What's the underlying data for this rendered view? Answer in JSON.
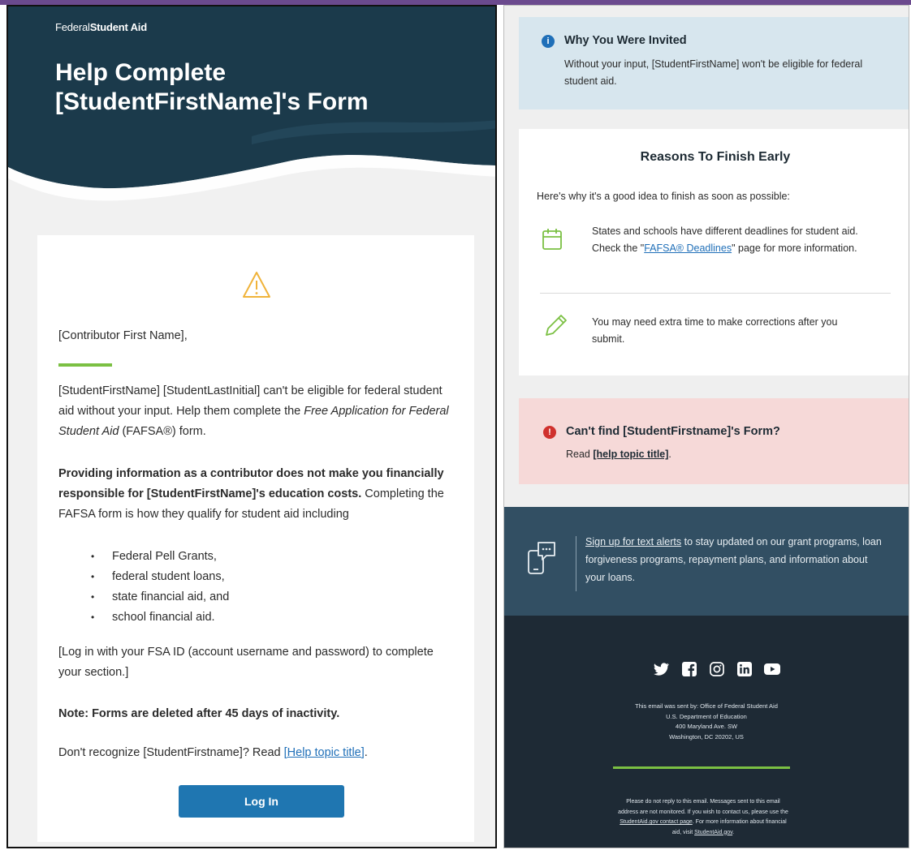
{
  "email_left": {
    "brand": {
      "prefix": "Federal",
      "suffix": "Student Aid"
    },
    "title": "Help Complete [StudentFirstName]'s Form",
    "greeting": "[Contributor First Name],",
    "para1": {
      "text_a": "[StudentFirstName] [StudentLastInitial] can't be eligible for federal student aid without your input. Help them complete the ",
      "italic": "Free Application for Federal Student Aid",
      "text_b": " (FAFSA®) form."
    },
    "para2": {
      "bold": "Providing information as a contributor does not make you financially responsible for [StudentFirstName]'s education costs.",
      "text": " Completing the FAFSA form is how they qualify for student aid including"
    },
    "aid_list": [
      "Federal Pell Grants,",
      "federal student loans,",
      "state financial aid, and",
      "school financial aid."
    ],
    "login_note": "[Log in with your FSA ID (account username and password) to complete your section.]",
    "deletion_note": "Note: Forms are deleted after 45 days of inactivity.",
    "dont_recognize": {
      "text": "Don't recognize [StudentFirstname]? Read ",
      "link": "[Help topic title]",
      "end": "."
    },
    "login_button": "Log In"
  },
  "email_right": {
    "invited": {
      "title": "Why You Were Invited",
      "body": "Without your input, [StudentFirstName] won't be eligible for federal student aid."
    },
    "reasons": {
      "title": "Reasons To Finish Early",
      "intro": "Here's why it's a good idea to finish as soon as possible:",
      "item1": {
        "text_a": "States and schools have different deadlines for student aid. Check the \"",
        "link": "FAFSA® Deadlines",
        "text_b": "\" page for more information."
      },
      "item2": "You may need extra time to make corrections after you submit."
    },
    "cant_find": {
      "title": "Can't find [StudentFirstname]'s Form?",
      "read": "Read ",
      "link": "[help topic title]",
      "end": "."
    },
    "alerts": {
      "link": "Sign up for text alerts",
      "text": " to stay updated on our grant programs, loan forgiveness programs, repayment plans, and information about your loans."
    },
    "footer": {
      "address": [
        "This email was sent by: Office of Federal Student Aid",
        "U.S. Department of Education",
        "400 Maryland Ave. SW",
        "Washington, DC 20202, US"
      ],
      "fine_a": "Please do not reply to this email. Messages sent to this email address are not monitored. If you wish to contact us, please use the ",
      "fine_link1": "StudentAid.gov contact page",
      "fine_b": ". For more information about financial aid, visit ",
      "fine_link2": "StudentAid.gov",
      "fine_end": "."
    },
    "socials": [
      "twitter-icon",
      "facebook-icon",
      "instagram-icon",
      "linkedin-icon",
      "youtube-icon"
    ]
  },
  "colors": {
    "navy": "#1b3a4b",
    "green": "#7bc043",
    "button": "#1f76b1",
    "info": "#d7e6ee",
    "error": "#f6d9d8",
    "footer": "#1e2a35"
  }
}
